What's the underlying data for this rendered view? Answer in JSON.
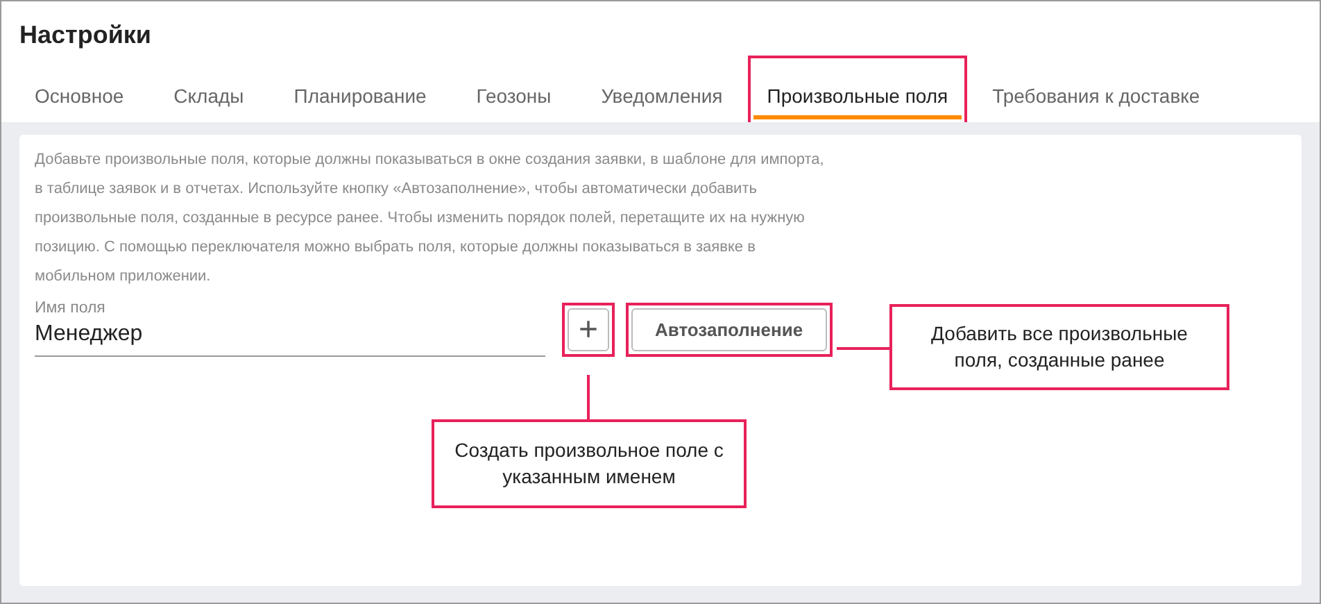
{
  "title": "Настройки",
  "tabs": [
    {
      "label": "Основное",
      "selected": false,
      "highlighted": false
    },
    {
      "label": "Склады",
      "selected": false,
      "highlighted": false
    },
    {
      "label": "Планирование",
      "selected": false,
      "highlighted": false
    },
    {
      "label": "Геозоны",
      "selected": false,
      "highlighted": false
    },
    {
      "label": "Уведомления",
      "selected": false,
      "highlighted": false
    },
    {
      "label": "Произвольные поля",
      "selected": true,
      "highlighted": true
    },
    {
      "label": "Требования к доставке",
      "selected": false,
      "highlighted": false
    }
  ],
  "description": "Добавьте произвольные поля, которые должны показываться в окне создания заявки, в шаблоне для импорта, в таблице заявок и в отчетах. Используйте кнопку «Автозаполнение», чтобы автоматически добавить произвольные поля, созданные в ресурсе ранее. Чтобы изменить порядок полей, перетащите их на нужную позицию. С помощью переключателя можно выбрать поля, которые должны показываться в заявке в мобильном приложении.",
  "field": {
    "label": "Имя поля",
    "value": "Менеджер"
  },
  "add_button": {
    "symbol": "+",
    "highlighted": true
  },
  "autofill_button": {
    "label": "Автозаполнение",
    "highlighted": true
  },
  "callouts": [
    {
      "kind": "right",
      "text": "Добавить все произвольные поля, созданные ранее"
    },
    {
      "kind": "below",
      "text": "Создать произвольное поле с указанным именем"
    }
  ]
}
